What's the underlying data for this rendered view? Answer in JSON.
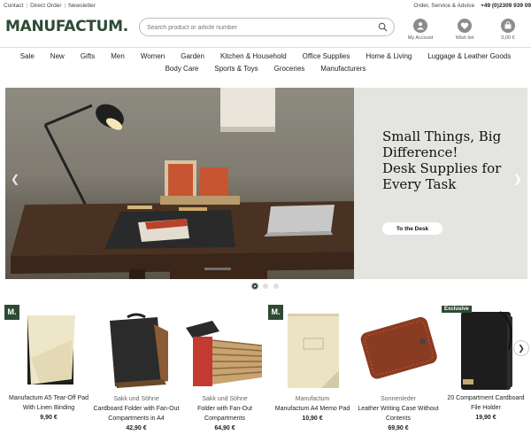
{
  "topbar": {
    "links": [
      "Contact",
      "Direct Order",
      "Newsletter"
    ],
    "service": "Order, Service & Advice",
    "phone": "+49 (0)2309 939 09"
  },
  "logo": "MANUFACTUM.",
  "search": {
    "placeholder": "Search product or article number"
  },
  "account": {
    "my_account": "My Account",
    "wishlist": "Wish list",
    "cart": "0,00 €"
  },
  "nav": {
    "row1": [
      "Sale",
      "New",
      "Gifts",
      "Men",
      "Women",
      "Garden",
      "Kitchen & Household",
      "Office Supplies",
      "Home & Living",
      "Luggage & Leather Goods"
    ],
    "row2": [
      "Body Care",
      "Sports & Toys",
      "Groceries",
      "Manufacturers"
    ]
  },
  "hero": {
    "headline_line1": "Small Things, Big",
    "headline_line2": "Difference!",
    "headline_line3": "Desk Supplies for",
    "headline_line4": "Every Task",
    "cta": "To the Desk",
    "slide_count": 3,
    "active_slide": 1
  },
  "products": [
    {
      "badge": "M.",
      "brand": "",
      "name": "Manufactum A5 Tear-Off Pad With Linen Binding",
      "price": "9,90 €"
    },
    {
      "badge": "",
      "brand": "Sakk und Söhne",
      "name": "Cardboard Folder with Fan-Out Compartments in A4",
      "price": "42,90 €"
    },
    {
      "badge": "",
      "brand": "Sakk und Söhne",
      "name": "Folder with Fan-Out Compartments",
      "price": "64,90 €"
    },
    {
      "badge": "M.",
      "brand": "Manufactum",
      "name": "Manufactum A4 Memo Pad",
      "price": "10,90 €"
    },
    {
      "badge": "",
      "brand": "Sonnenleder",
      "name": "Leather Writing Case Without Contents",
      "price": "69,90 €"
    },
    {
      "badge": "Exclusive",
      "brand": "",
      "name": "20 Compartment Cardboard File Holder",
      "price": "19,90 €"
    }
  ]
}
